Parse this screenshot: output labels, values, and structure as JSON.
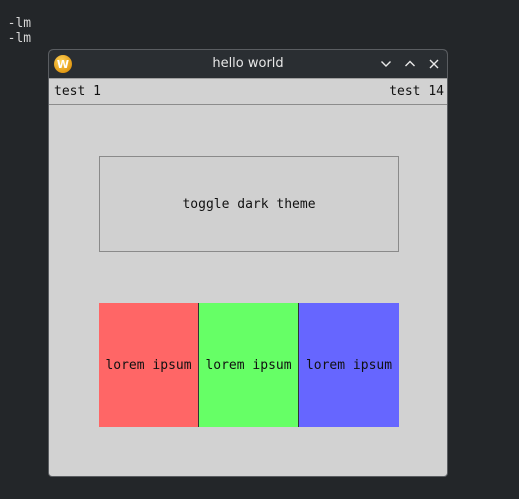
{
  "terminal": {
    "lines": [
      "w -lm",
      "w -lm"
    ]
  },
  "window": {
    "title": "hello world",
    "icon": "app-logo-icon",
    "icon_letter": "W",
    "controls": [
      "minimize-icon",
      "maximize-icon",
      "close-icon"
    ]
  },
  "menubar": {
    "left_text": "test 1",
    "right_text": "test 14"
  },
  "main": {
    "toggle_label": "toggle dark theme",
    "panels": [
      {
        "label": "lorem ipsum",
        "color": "#ff6666"
      },
      {
        "label": "lorem ipsum",
        "color": "#66ff66"
      },
      {
        "label": "lorem ipsum",
        "color": "#6666ff"
      }
    ]
  },
  "colors": {
    "desktop_bg": "#232629",
    "titlebar_bg": "#2a2e32",
    "window_bg": "#d2d2d2"
  }
}
